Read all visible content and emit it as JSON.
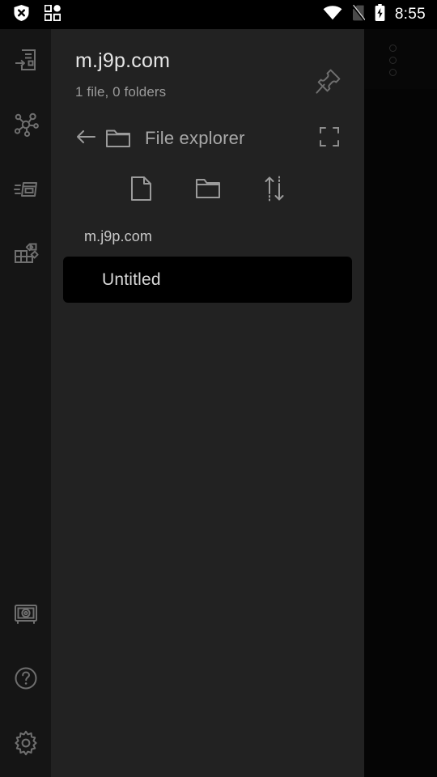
{
  "status_bar": {
    "icons_left": [
      {
        "name": "shield-x-icon",
        "label": "VPN blocked"
      },
      {
        "name": "app-grid-icon",
        "label": "Apps"
      }
    ],
    "icons_right": [
      {
        "name": "wifi-icon",
        "label": "Wi-Fi connected"
      },
      {
        "name": "no-sim-icon",
        "label": "No SIM card"
      },
      {
        "name": "battery-charging-icon",
        "label": "Battery charging"
      }
    ],
    "time": "8:55"
  },
  "sidebar": {
    "top_items": [
      {
        "name": "sidebar-item-notes",
        "icon": "note-import-icon",
        "label": "Notes"
      },
      {
        "name": "sidebar-item-graph",
        "icon": "graph-nodes-icon",
        "label": "Graph"
      },
      {
        "name": "sidebar-item-cards",
        "icon": "card-stack-icon",
        "label": "Cards"
      },
      {
        "name": "sidebar-item-blocks",
        "icon": "blocks-grid-icon",
        "label": "Blocks"
      }
    ],
    "bottom_items": [
      {
        "name": "sidebar-item-vault",
        "icon": "safe-vault-icon",
        "label": "Vault"
      },
      {
        "name": "sidebar-item-help",
        "icon": "help-circle-icon",
        "label": "Help"
      },
      {
        "name": "sidebar-item-settings",
        "icon": "gear-icon",
        "label": "Settings"
      }
    ]
  },
  "panel": {
    "title": "m.j9p.com",
    "subtitle": "1 file, 0 folders",
    "pin_label": "Pin",
    "section": {
      "back_label": "Back",
      "title": "File explorer",
      "expand_label": "Expand"
    },
    "actions": [
      {
        "name": "new-file-button",
        "icon": "file-icon",
        "label": "New file"
      },
      {
        "name": "new-folder-button",
        "icon": "folder-icon",
        "label": "New folder"
      },
      {
        "name": "sort-button",
        "icon": "sort-arrows-icon",
        "label": "Sort"
      }
    ],
    "breadcrumb": "m.j9p.com",
    "files": [
      {
        "name": "Untitled",
        "selected": true
      }
    ]
  },
  "overlay": {
    "overflow_menu_label": "More options"
  },
  "colors": {
    "status_bar_bg": "#000000",
    "sidebar_bg": "#151515",
    "panel_bg": "#222222",
    "backdrop_bg": "#050505",
    "selected_item_bg": "#000000",
    "title_text": "#e6e6e6",
    "muted_text": "#9a9a9a",
    "icon_stroke": "#8a8a8a"
  }
}
